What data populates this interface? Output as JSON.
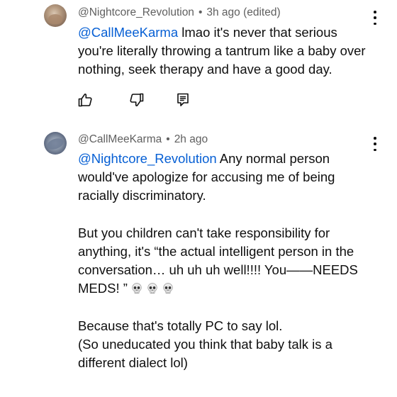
{
  "comments": [
    {
      "username": "@Nightcore_Revolution",
      "timestamp": "3h ago (edited)",
      "mention": "@CallMeeKarma",
      "body": "lmao it's never that serious you're literally throwing a tantrum like a baby over nothing, seek therapy and have a good day.",
      "actions": {
        "like_icon": "thumbs-up-icon",
        "dislike_icon": "thumbs-down-icon",
        "reply_icon": "reply-icon"
      }
    },
    {
      "username": "@CallMeeKarma",
      "timestamp": "2h ago",
      "mention": "@Nightcore_Revolution",
      "body_line1": "Any normal person would've apologize for accusing me of being racially discriminatory.",
      "body_line2": "But you children can't take responsibility for anything, it's “the actual intelligent person in the conversation… uh uh uh well!!!! You——NEEDS MEDS! ”",
      "body_emojis": "skull-emoji x3",
      "body_line3": "Because that's totally PC to say lol.",
      "body_line4": "(So uneducated you think that baby talk is a different dialect lol)"
    }
  ],
  "meta_separator": "•",
  "colors": {
    "mention": "#065fd4",
    "meta": "#606060",
    "text": "#0f0f0f"
  }
}
